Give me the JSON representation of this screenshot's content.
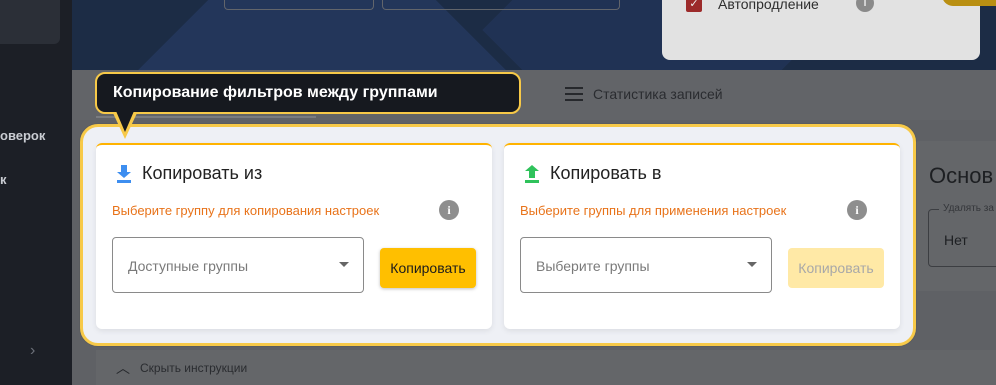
{
  "sidebar": {
    "items": [
      {
        "label": "оверок"
      },
      {
        "label": "к"
      }
    ]
  },
  "header": {
    "autorenew_label": "Автопродление",
    "autorenew_checked": true
  },
  "tabs": {
    "stats_label": "Статистика записей"
  },
  "right_panel": {
    "title": "Основ",
    "field_label": "Удалять за",
    "field_value": "Нет"
  },
  "instructions": {
    "hide_label": "Скрыть инструкции"
  },
  "tooltip": {
    "text": "Копирование фильтров между группами"
  },
  "copy_from": {
    "title": "Копировать из",
    "hint": "Выберите группу для копирования настроек",
    "select_placeholder": "Доступные группы",
    "button_label": "Копировать",
    "button_enabled": true,
    "icon": "download-arrow-icon",
    "icon_color": "#3d8ef0"
  },
  "copy_to": {
    "title": "Копировать в",
    "hint": "Выберите группы для применения настроек",
    "select_placeholder": "Выберите группы",
    "button_label": "Копировать",
    "button_enabled": false,
    "icon": "upload-arrow-icon",
    "icon_color": "#2fc25b"
  },
  "colors": {
    "accent": "#ffbf00",
    "highlight_border": "#f7c948",
    "hint": "#e8731a",
    "tooltip_bg": "#16191f"
  }
}
